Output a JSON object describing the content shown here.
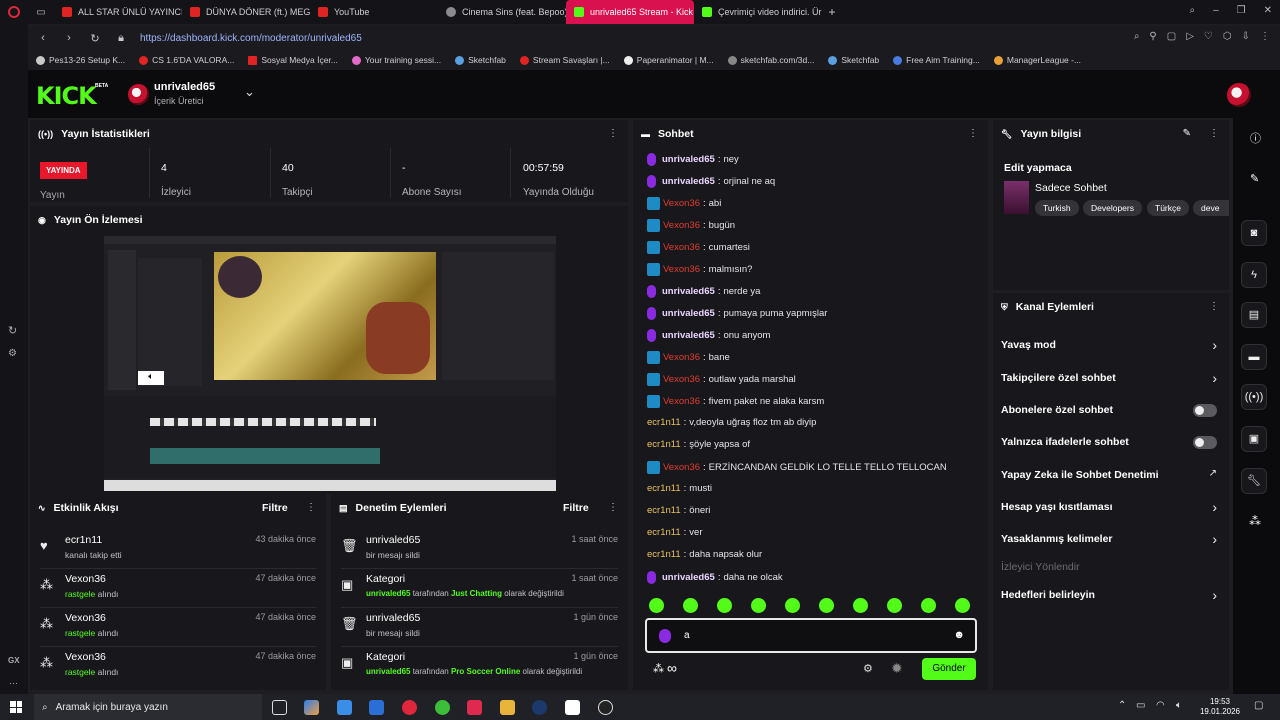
{
  "browser": {
    "tabs": [
      {
        "label": "ALL STAR ÜNLÜ YAYINCIL",
        "color": "#e02424"
      },
      {
        "label": "DÜNYA DÖNER (ft.) MEG",
        "color": "#e02424"
      },
      {
        "label": "YouTube",
        "color": "#e02424"
      },
      {
        "label": "Cinema Sins (feat. Bepoo)",
        "color": "#8a8a90"
      },
      {
        "label": "unrivaled65 Stream - Kick",
        "color": "#53fc18"
      },
      {
        "label": "Çevrimiçi video indirici. Ür",
        "color": "#53fc18"
      }
    ],
    "new_tab": "+",
    "url": "https://dashboard.kick.com/moderator/unrivaled65",
    "bookmarks": [
      "Pes13-26 Setup K...",
      "CS 1.6'DA VALORA...",
      "Sosyal Medya İçer...",
      "Your training sessi...",
      "Sketchfab",
      "Stream Savaşları |...",
      "Paperanimator | M...",
      "sketchfab.com/3d...",
      "Sketchfab",
      "Free Aim Training...",
      "ManagerLeague -..."
    ]
  },
  "header": {
    "logo": "KICK",
    "beta": "BETA",
    "channel_name": "unrivaled65",
    "channel_role": "İçerik Üretici"
  },
  "stats_panel": {
    "title": "Yayın İstatistikleri",
    "live_badge": "YAYINDA",
    "live_label": "Yayın",
    "items": [
      {
        "value": "4",
        "label": "İzleyici"
      },
      {
        "value": "40",
        "label": "Takipçi"
      },
      {
        "value": "-",
        "label": "Abone Sayısı"
      },
      {
        "value": "00:57:59",
        "label": "Yayında Olduğu"
      }
    ]
  },
  "preview_panel": {
    "title": "Yayın Ön İzlemesi"
  },
  "activity_panel": {
    "title": "Etkinlik Akışı",
    "filter": "Filtre",
    "items": [
      {
        "name": "ecr1n11",
        "sub": "kanalı takip etti",
        "time": "43 dakika önce",
        "icon": "heart-icon"
      },
      {
        "name": "Vexon36",
        "sub_a": "rastgele",
        "sub_b": " alındı",
        "time": "47 dakika önce",
        "icon": "kick-points-icon"
      },
      {
        "name": "Vexon36",
        "sub_a": "rastgele",
        "sub_b": " alındı",
        "time": "47 dakika önce",
        "icon": "kick-points-icon"
      },
      {
        "name": "Vexon36",
        "sub_a": "rastgele",
        "sub_b": " alındı",
        "time": "47 dakika önce",
        "icon": "kick-points-icon"
      }
    ]
  },
  "moderation_panel": {
    "title": "Denetim Eylemleri",
    "filter": "Filtre",
    "items": [
      {
        "name": "unrivaled65",
        "sub": "bir mesajı sildi",
        "time": "1 saat önce"
      },
      {
        "name": "Kategori",
        "sub_user": "unrivaled65",
        "sub_mid": " tarafından ",
        "sub_cat": "Just Chatting",
        "sub_end": " olarak değiştirildi",
        "time": "1 saat önce"
      },
      {
        "name": "unrivaled65",
        "sub": "bir mesajı sildi",
        "time": "1 gün önce"
      },
      {
        "name": "Kategori",
        "sub_user": "unrivaled65",
        "sub_mid": " tarafından ",
        "sub_cat": "Pro Soccer Online",
        "sub_end": " olarak değiştirildi",
        "time": "1 gün önce"
      }
    ]
  },
  "chat": {
    "title": "Sohbet",
    "messages": [
      {
        "user": "unrivaled65",
        "text": "ney",
        "badge": "mic"
      },
      {
        "user": "unrivaled65",
        "text": "orjinal ne aq",
        "badge": "mic"
      },
      {
        "user": "Vexon36",
        "text": "abi",
        "badge": "kb"
      },
      {
        "user": "Vexon36",
        "text": "bugün",
        "badge": "kb"
      },
      {
        "user": "Vexon36",
        "text": "cumartesi",
        "badge": "kb"
      },
      {
        "user": "Vexon36",
        "text": "malmısın?",
        "badge": "kb"
      },
      {
        "user": "unrivaled65",
        "text": "nerde ya",
        "badge": "mic"
      },
      {
        "user": "unrivaled65",
        "text": "pumaya puma yapmışlar",
        "badge": "mic"
      },
      {
        "user": "unrivaled65",
        "text": "onu anyom",
        "badge": "mic"
      },
      {
        "user": "Vexon36",
        "text": "bane",
        "badge": "kb"
      },
      {
        "user": "Vexon36",
        "text": "outlaw yada marshal",
        "badge": "kb"
      },
      {
        "user": "Vexon36",
        "text": "fivem paket ne alaka karsm",
        "badge": "kb"
      },
      {
        "user": "ecr1n11",
        "text": "v,deoyla uğraş floz tm ab diyip",
        "badge": ""
      },
      {
        "user": "ecr1n11",
        "text": "şöyle yapsa of",
        "badge": ""
      },
      {
        "user": "Vexon36",
        "text": "ERZİNCANDAN GELDİK LO TELLE TELLO TELLOCAN",
        "badge": "kb"
      },
      {
        "user": "ecr1n11",
        "text": "musti",
        "badge": ""
      },
      {
        "user": "ecr1n11",
        "text": "öneri",
        "badge": ""
      },
      {
        "user": "ecr1n11",
        "text": "ver",
        "badge": ""
      },
      {
        "user": "ecr1n11",
        "text": "daha napsak olur",
        "badge": ""
      },
      {
        "user": "unrivaled65",
        "text": "daha ne olcak",
        "badge": "mic"
      }
    ],
    "input_value": "a",
    "send_button": "Gönder"
  },
  "stream_info": {
    "title": "Yayın bilgisi",
    "stream_title": "Edit yapmaca",
    "category": "Sadece Sohbet",
    "tags": [
      "Turkish",
      "Developers",
      "Türkçe",
      "deve"
    ]
  },
  "channel_actions": {
    "title": "Kanal Eylemleri",
    "items": [
      {
        "label": "Yavaş mod",
        "control": "chevron"
      },
      {
        "label": "Takipçilere özel sohbet",
        "control": "chevron"
      },
      {
        "label": "Abonelere özel sohbet",
        "control": "toggle"
      },
      {
        "label": "Yalnızca ifadelerle sohbet",
        "control": "toggle"
      },
      {
        "label": "Yapay Zeka ile Sohbet Denetimi",
        "control": "external"
      },
      {
        "label": "Hesap yaşı kısıtlaması",
        "control": "chevron"
      },
      {
        "label": "Yasaklanmış kelimeler",
        "control": "chevron"
      },
      {
        "label": "İzleyici Yönlendir",
        "control": "disabled"
      },
      {
        "label": "Hedefleri belirleyin",
        "control": "chevron"
      }
    ]
  },
  "taskbar": {
    "search_placeholder": "Aramak için buraya yazın",
    "time": "19:53",
    "date": "19.01.2026"
  },
  "colors": {
    "kick_green": "#53fc18",
    "live_red": "#e8172c",
    "panel_bg": "#18181c"
  }
}
